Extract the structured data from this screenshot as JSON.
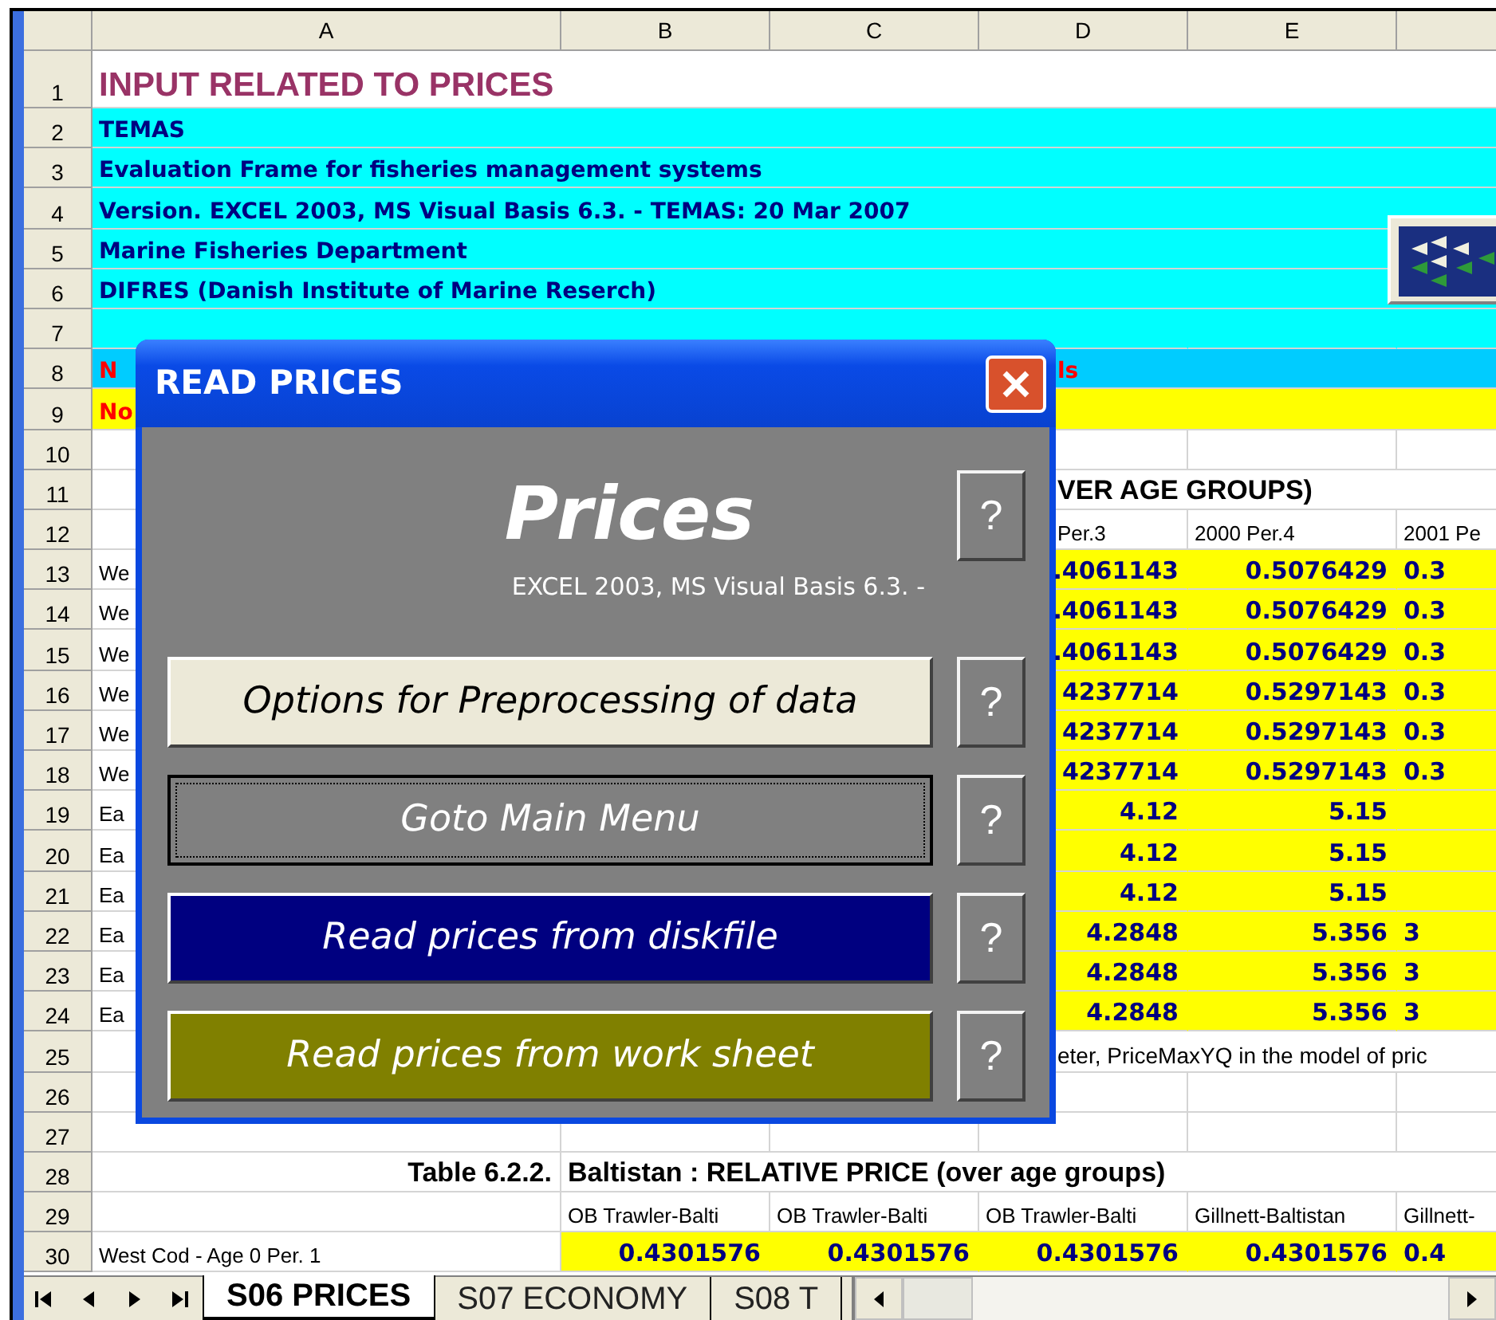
{
  "sheet": {
    "columns": [
      "A",
      "B",
      "C",
      "D",
      "E"
    ],
    "rows": [
      {
        "number": "1",
        "kind": "title",
        "cells": [
          "INPUT RELATED TO PRICES",
          "",
          "",
          "",
          "",
          ""
        ]
      },
      {
        "number": "2",
        "kind": "banner",
        "cells": [
          "TEMAS",
          "",
          "",
          "",
          "",
          ""
        ]
      },
      {
        "number": "3",
        "kind": "banner",
        "cells": [
          "Evaluation Frame for fisheries management systems",
          "",
          "",
          "",
          "",
          ""
        ]
      },
      {
        "number": "4",
        "kind": "banner",
        "cells": [
          "Version. EXCEL 2003, MS Visual Basis 6.3. - TEMAS: 20 Mar 2007",
          "",
          "",
          "",
          "",
          ""
        ]
      },
      {
        "number": "5",
        "kind": "banner",
        "cells": [
          "Marine Fisheries Department",
          "",
          "",
          "",
          "",
          ""
        ]
      },
      {
        "number": "6",
        "kind": "banner",
        "cells": [
          "DIFRES (Danish Institute of Marine Reserch)",
          "",
          "",
          "",
          "",
          ""
        ]
      },
      {
        "number": "7",
        "kind": "banner",
        "cells": [
          "",
          "",
          "",
          "",
          "",
          ""
        ]
      },
      {
        "number": "8",
        "kind": "alert_sky",
        "cells": [
          "N",
          "",
          "",
          "ls",
          "",
          ""
        ]
      },
      {
        "number": "9",
        "kind": "alert_yellow",
        "cells": [
          "No",
          "",
          "",
          "",
          "",
          ""
        ]
      },
      {
        "number": "10",
        "kind": "blank",
        "cells": [
          "",
          "",
          "",
          "",
          "",
          ""
        ]
      },
      {
        "number": "11",
        "kind": "caption",
        "cells": [
          "",
          "",
          "",
          "VER AGE GROUPS)",
          "",
          ""
        ]
      },
      {
        "number": "12",
        "kind": "subheader",
        "cells": [
          "",
          "",
          "",
          "Per.3",
          "2000 Per.4",
          "2001 Pe"
        ]
      },
      {
        "number": "13",
        "kind": "values",
        "cells": [
          "We",
          "",
          "",
          ".4061143",
          "0.5076429",
          "0.3"
        ]
      },
      {
        "number": "14",
        "kind": "values",
        "cells": [
          "We",
          "",
          "",
          ".4061143",
          "0.5076429",
          "0.3"
        ]
      },
      {
        "number": "15",
        "kind": "values",
        "cells": [
          "We",
          "",
          "",
          ".4061143",
          "0.5076429",
          "0.3"
        ]
      },
      {
        "number": "16",
        "kind": "values",
        "cells": [
          "We",
          "",
          "",
          "4237714",
          "0.5297143",
          "0.3"
        ]
      },
      {
        "number": "17",
        "kind": "values",
        "cells": [
          "We",
          "",
          "",
          "4237714",
          "0.5297143",
          "0.3"
        ]
      },
      {
        "number": "18",
        "kind": "values",
        "cells": [
          "We",
          "",
          "",
          "4237714",
          "0.5297143",
          "0.3"
        ]
      },
      {
        "number": "19",
        "kind": "values",
        "cells": [
          "Ea",
          "",
          "",
          "4.12",
          "5.15",
          ""
        ]
      },
      {
        "number": "20",
        "kind": "values",
        "cells": [
          "Ea",
          "",
          "",
          "4.12",
          "5.15",
          ""
        ]
      },
      {
        "number": "21",
        "kind": "values",
        "cells": [
          "Ea",
          "",
          "",
          "4.12",
          "5.15",
          ""
        ]
      },
      {
        "number": "22",
        "kind": "values",
        "cells": [
          "Ea",
          "",
          "",
          "4.2848",
          "5.356",
          "3"
        ]
      },
      {
        "number": "23",
        "kind": "values",
        "cells": [
          "Ea",
          "",
          "",
          "4.2848",
          "5.356",
          "3"
        ]
      },
      {
        "number": "24",
        "kind": "values",
        "cells": [
          "Ea",
          "",
          "",
          "4.2848",
          "5.356",
          "3"
        ]
      },
      {
        "number": "25",
        "kind": "note",
        "cells": [
          "",
          "",
          "",
          "eter, PriceMaxYQ in the model of pric",
          "",
          ""
        ]
      },
      {
        "number": "26",
        "kind": "blank",
        "cells": [
          "",
          "",
          "",
          "",
          "",
          ""
        ]
      },
      {
        "number": "27",
        "kind": "blank",
        "cells": [
          "",
          "",
          "",
          "",
          "",
          ""
        ]
      },
      {
        "number": "28",
        "kind": "table_title",
        "cells": [
          "Table 6.2.2.",
          "Baltistan : RELATIVE PRICE (over age groups)",
          "",
          "",
          "",
          ""
        ]
      },
      {
        "number": "29",
        "kind": "column_labels",
        "cells": [
          "",
          "OB Trawler-Balti",
          "OB Trawler-Balti",
          "OB Trawler-Balti",
          "Gillnett-Baltistan",
          "Gillnett-"
        ]
      },
      {
        "number": "30",
        "kind": "values",
        "cells": [
          "West Cod - Age 0 Per. 1",
          "0.4301576",
          "0.4301576",
          "0.4301576",
          "0.4301576",
          "0.4"
        ]
      }
    ]
  },
  "dialog": {
    "title": "READ PRICES",
    "heading": "Prices",
    "subtitle": "EXCEL 2003, MS Visual Basis 6.3. -",
    "heading_help": "?",
    "buttons": [
      {
        "label": "Options for Preprocessing of data",
        "color": "#ece9d8",
        "kind": "light",
        "focused": false,
        "help": "?"
      },
      {
        "label": "Goto Main Menu",
        "color": "#808080",
        "kind": "dark",
        "focused": true,
        "help": "?"
      },
      {
        "label": "Read prices from diskfile",
        "color": "#000080",
        "kind": "dark",
        "focused": false,
        "help": "?"
      },
      {
        "label": "Read prices from work sheet",
        "color": "#808000",
        "kind": "dark",
        "focused": false,
        "help": "?"
      }
    ]
  },
  "sheet_tabs": [
    {
      "label": "S06 PRICES",
      "selected": true
    },
    {
      "label": "S07 ECONOMY",
      "selected": false
    },
    {
      "label": "S08 T",
      "selected": false
    }
  ]
}
